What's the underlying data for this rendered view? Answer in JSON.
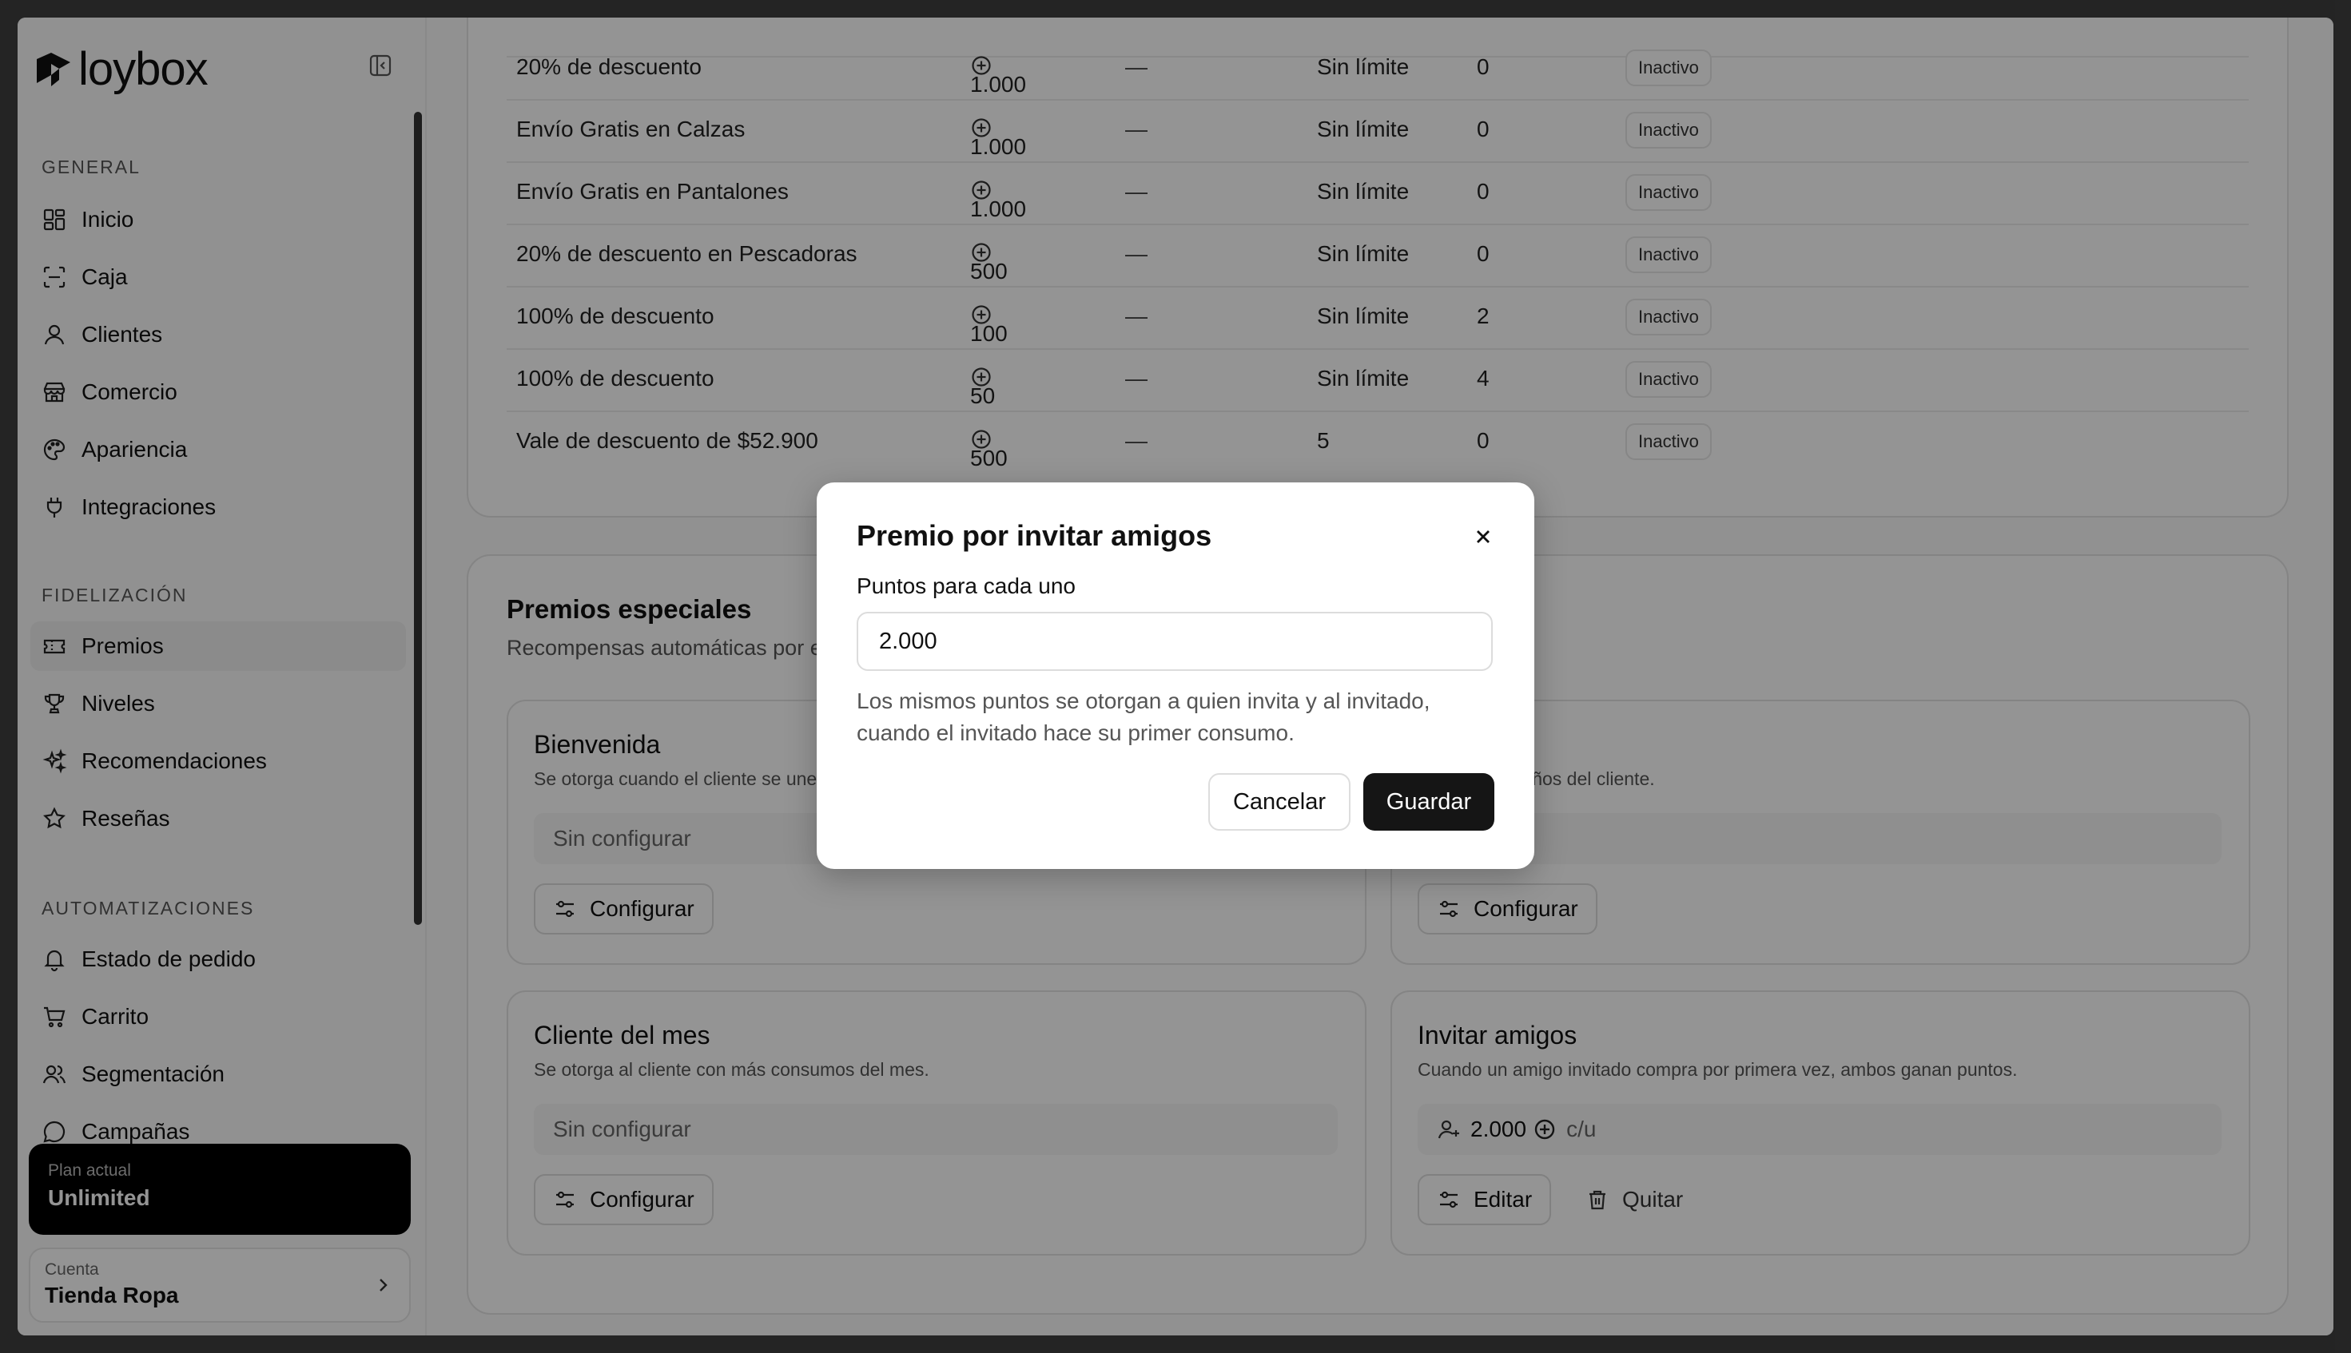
{
  "brand": {
    "name": "loybox"
  },
  "sidebar": {
    "sections": [
      {
        "label": "General",
        "items": [
          {
            "label": "Inicio",
            "icon": "grid-icon"
          },
          {
            "label": "Caja",
            "icon": "scan-icon"
          },
          {
            "label": "Clientes",
            "icon": "user-icon"
          },
          {
            "label": "Comercio",
            "icon": "store-icon"
          },
          {
            "label": "Apariencia",
            "icon": "palette-icon"
          },
          {
            "label": "Integraciones",
            "icon": "plug-icon"
          }
        ]
      },
      {
        "label": "Fidelización",
        "items": [
          {
            "label": "Premios",
            "icon": "ticket-icon",
            "active": true
          },
          {
            "label": "Niveles",
            "icon": "trophy-icon"
          },
          {
            "label": "Recomendaciones",
            "icon": "sparkles-icon"
          },
          {
            "label": "Reseñas",
            "icon": "star-icon"
          }
        ]
      },
      {
        "label": "Automatizaciones",
        "items": [
          {
            "label": "Estado de pedido",
            "icon": "bell-icon"
          },
          {
            "label": "Carrito",
            "icon": "cart-icon"
          },
          {
            "label": "Segmentación",
            "icon": "users-icon"
          },
          {
            "label": "Campañas",
            "icon": "chat-icon"
          }
        ]
      }
    ],
    "plan": {
      "label": "Plan actual",
      "value": "Unlimited"
    },
    "account": {
      "label": "Cuenta",
      "value": "Tienda Ropa"
    }
  },
  "rewards_table": {
    "rows": [
      {
        "name": "20% de descuento",
        "points": "1.000",
        "dash": "—",
        "limit": "Sin límite",
        "used": "0",
        "status": "Inactivo"
      },
      {
        "name": "Envío Gratis en Calzas",
        "points": "1.000",
        "dash": "—",
        "limit": "Sin límite",
        "used": "0",
        "status": "Inactivo"
      },
      {
        "name": "Envío Gratis en Pantalones",
        "points": "1.000",
        "dash": "—",
        "limit": "Sin límite",
        "used": "0",
        "status": "Inactivo"
      },
      {
        "name": "20% de descuento en Pescadoras",
        "points": "500",
        "dash": "—",
        "limit": "Sin límite",
        "used": "0",
        "status": "Inactivo"
      },
      {
        "name": "100% de descuento",
        "points": "100",
        "dash": "—",
        "limit": "Sin límite",
        "used": "2",
        "status": "Inactivo"
      },
      {
        "name": "100% de descuento",
        "points": "50",
        "dash": "—",
        "limit": "Sin límite",
        "used": "4",
        "status": "Inactivo"
      },
      {
        "name": "Vale de descuento de $52.900",
        "points": "500",
        "dash": "—",
        "limit": "5",
        "used": "0",
        "status": "Inactivo"
      }
    ]
  },
  "special": {
    "title": "Premios especiales",
    "subtitle": "Recompensas automáticas por e",
    "boxes": [
      {
        "title": "Bienvenida",
        "desc": "Se otorga cuando el cliente se une",
        "field": "Sin configurar",
        "button": "Configurar"
      },
      {
        "title": "os",
        "desc": "a del cumpleaños del cliente.",
        "field": "urar",
        "button": "Configurar"
      },
      {
        "title": "Cliente del mes",
        "desc": "Se otorga al cliente con más consumos del mes.",
        "field": "Sin configurar",
        "button": "Configurar"
      },
      {
        "title": "Invitar amigos",
        "desc": "Cuando un amigo invitado compra por primera vez, ambos ganan puntos.",
        "field_value": "2.000",
        "field_unit": "c/u",
        "button": "Editar",
        "remove": "Quitar"
      }
    ]
  },
  "modal": {
    "title": "Premio por invitar amigos",
    "field_label": "Puntos para cada uno",
    "field_value": "2.000",
    "help": "Los mismos puntos se otorgan a quien invita y al invitado, cuando el invitado hace su primer consumo.",
    "cancel": "Cancelar",
    "save": "Guardar"
  }
}
